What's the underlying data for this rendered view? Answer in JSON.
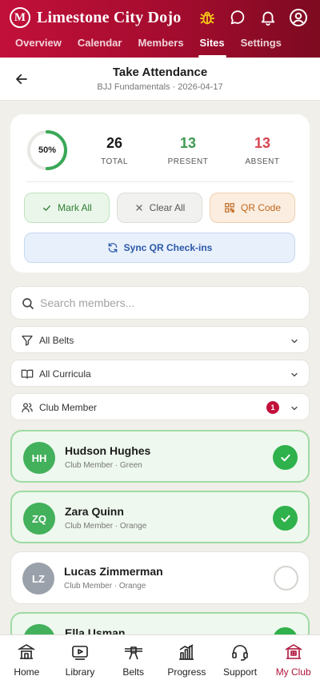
{
  "header": {
    "title": "Limestone City Dojo",
    "logo_letter": "M",
    "tabs": [
      {
        "label": "Overview"
      },
      {
        "label": "Calendar"
      },
      {
        "label": "Members"
      },
      {
        "label": "Sites"
      },
      {
        "label": "Settings"
      }
    ],
    "active_tab": "Sites",
    "icons": [
      "bug-icon",
      "chat-icon",
      "bell-icon",
      "user-icon"
    ]
  },
  "titlebar": {
    "title": "Take Attendance",
    "subtitle": "BJJ Fundamentals · 2026-04-17"
  },
  "stats": {
    "percent_label": "50%",
    "percent_value": 0.5,
    "total": {
      "value": "26",
      "label": "TOTAL"
    },
    "present": {
      "value": "13",
      "label": "PRESENT"
    },
    "absent": {
      "value": "13",
      "label": "ABSENT"
    }
  },
  "actions": {
    "mark_all": "Mark All",
    "clear_all": "Clear All",
    "qr_code": "QR Code",
    "sync": "Sync QR Check-ins"
  },
  "search": {
    "placeholder": "Search members...",
    "value": ""
  },
  "filters": {
    "belts": "All Belts",
    "curricula": "All Curricula",
    "member_type": "Club Member",
    "member_type_badge": "1"
  },
  "members": [
    {
      "initials": "HH",
      "name": "Hudson Hughes",
      "meta": "Club Member · Green",
      "present": true
    },
    {
      "initials": "ZQ",
      "name": "Zara Quinn",
      "meta": "Club Member · Orange",
      "present": true
    },
    {
      "initials": "LZ",
      "name": "Lucas Zimmerman",
      "meta": "Club Member · Orange",
      "present": false
    },
    {
      "initials": "EU",
      "name": "Ella Usman",
      "meta": "",
      "present": true
    }
  ],
  "bottom_nav": [
    {
      "label": "Home"
    },
    {
      "label": "Library"
    },
    {
      "label": "Belts"
    },
    {
      "label": "Progress"
    },
    {
      "label": "Support"
    },
    {
      "label": "My Club"
    }
  ],
  "colors": {
    "brand": "#b0143a",
    "present_green": "#2fb14b",
    "absent_red": "#d64550",
    "avatar_present": "#43b05c",
    "avatar_absent": "#9aa1aa"
  }
}
